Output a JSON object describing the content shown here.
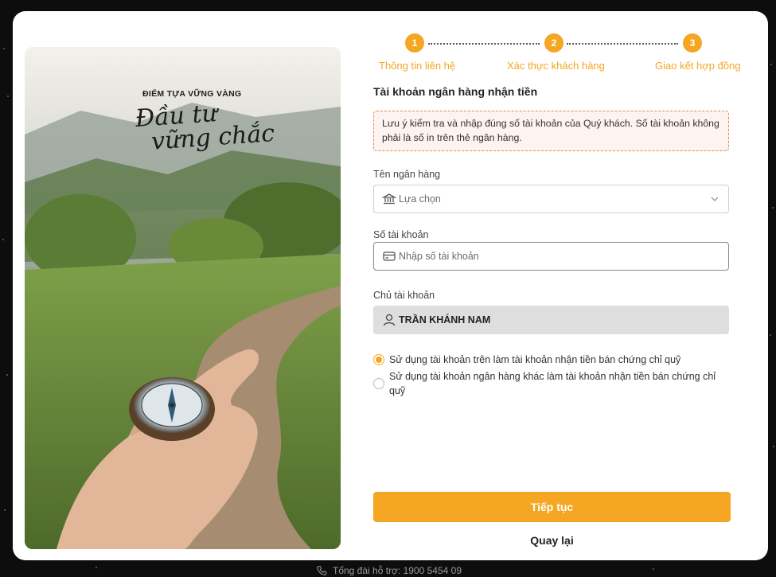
{
  "hero": {
    "tagline": "ĐIỂM TỰA VỮNG VÀNG",
    "script_line1": "Đầu tư",
    "script_line2": "vững chắc"
  },
  "stepper": {
    "steps": [
      {
        "number": "1",
        "label": "Thông tin liên hệ"
      },
      {
        "number": "2",
        "label": "Xác thực khách hàng"
      },
      {
        "number": "3",
        "label": "Giao kết hợp đồng"
      }
    ],
    "accent_color": "#f5a623"
  },
  "form": {
    "title": "Tài khoản ngân hàng nhận tiền",
    "notice": "Lưu ý kiểm tra và nhập đúng số tài khoản của Quý khách. Số tài khoản không phải là số in trên thẻ ngân hàng.",
    "bank": {
      "label": "Tên ngân hàng",
      "placeholder": "Lựa chọn",
      "icon": "bank-icon"
    },
    "account_number": {
      "label": "Số tài khoản",
      "placeholder": "Nhập số tài khoản",
      "icon": "card-icon"
    },
    "account_holder": {
      "label": "Chủ tài khoản",
      "value": "TRẦN KHÁNH NAM",
      "icon": "user-icon"
    },
    "options": [
      {
        "label": "Sử dụng tài khoản trên làm tài khoản nhận tiền bán chứng chỉ quỹ",
        "selected": true
      },
      {
        "label": "Sử dụng tài khoản ngân hàng khác làm tài khoản nhận tiền bán chứng chỉ quỹ",
        "selected": false
      }
    ],
    "continue_label": "Tiếp tục",
    "back_label": "Quay lại"
  },
  "footer": {
    "hotline": "Tổng đài hỗ trợ: 1900 5454 09",
    "icon": "phone-icon"
  }
}
